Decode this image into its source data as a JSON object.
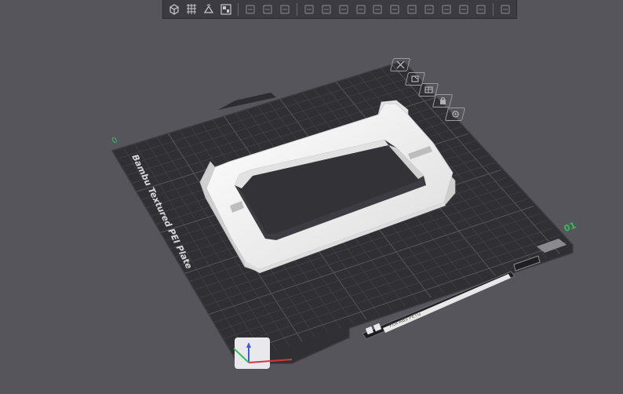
{
  "plate": {
    "name": "Bambu Textured PEI Plate",
    "filament_tag": "PLA ABS PETG",
    "axis_x_label": "01",
    "axis_y_label": "0"
  },
  "toolbar": {
    "groups": [
      [
        "add-icon",
        "grid-icon",
        "orient-icon",
        "arrange-icon"
      ],
      [
        "copy-icon",
        "instance-icon",
        "layers-icon"
      ],
      [
        "move-icon",
        "rotate-icon",
        "scale-icon",
        "lay-flat-icon",
        "cut-icon",
        "mesh-boolean-icon",
        "support-paint-icon",
        "seam-paint-icon",
        "text-icon",
        "measure-icon",
        "assemble-icon"
      ],
      [
        "view-cube-icon"
      ]
    ]
  },
  "plate_buttons": [
    "close-icon",
    "auto-orient-icon",
    "arrange-plate-icon",
    "lock-icon",
    "settings-icon"
  ],
  "colors": {
    "background": "#56555c",
    "plate": "#2f2f34",
    "grid": "#4a4a50",
    "model": "#f2f2f2",
    "axis_x": "#d23a3a",
    "axis_y": "#2fbf5a",
    "axis_z": "#3a5be0"
  }
}
